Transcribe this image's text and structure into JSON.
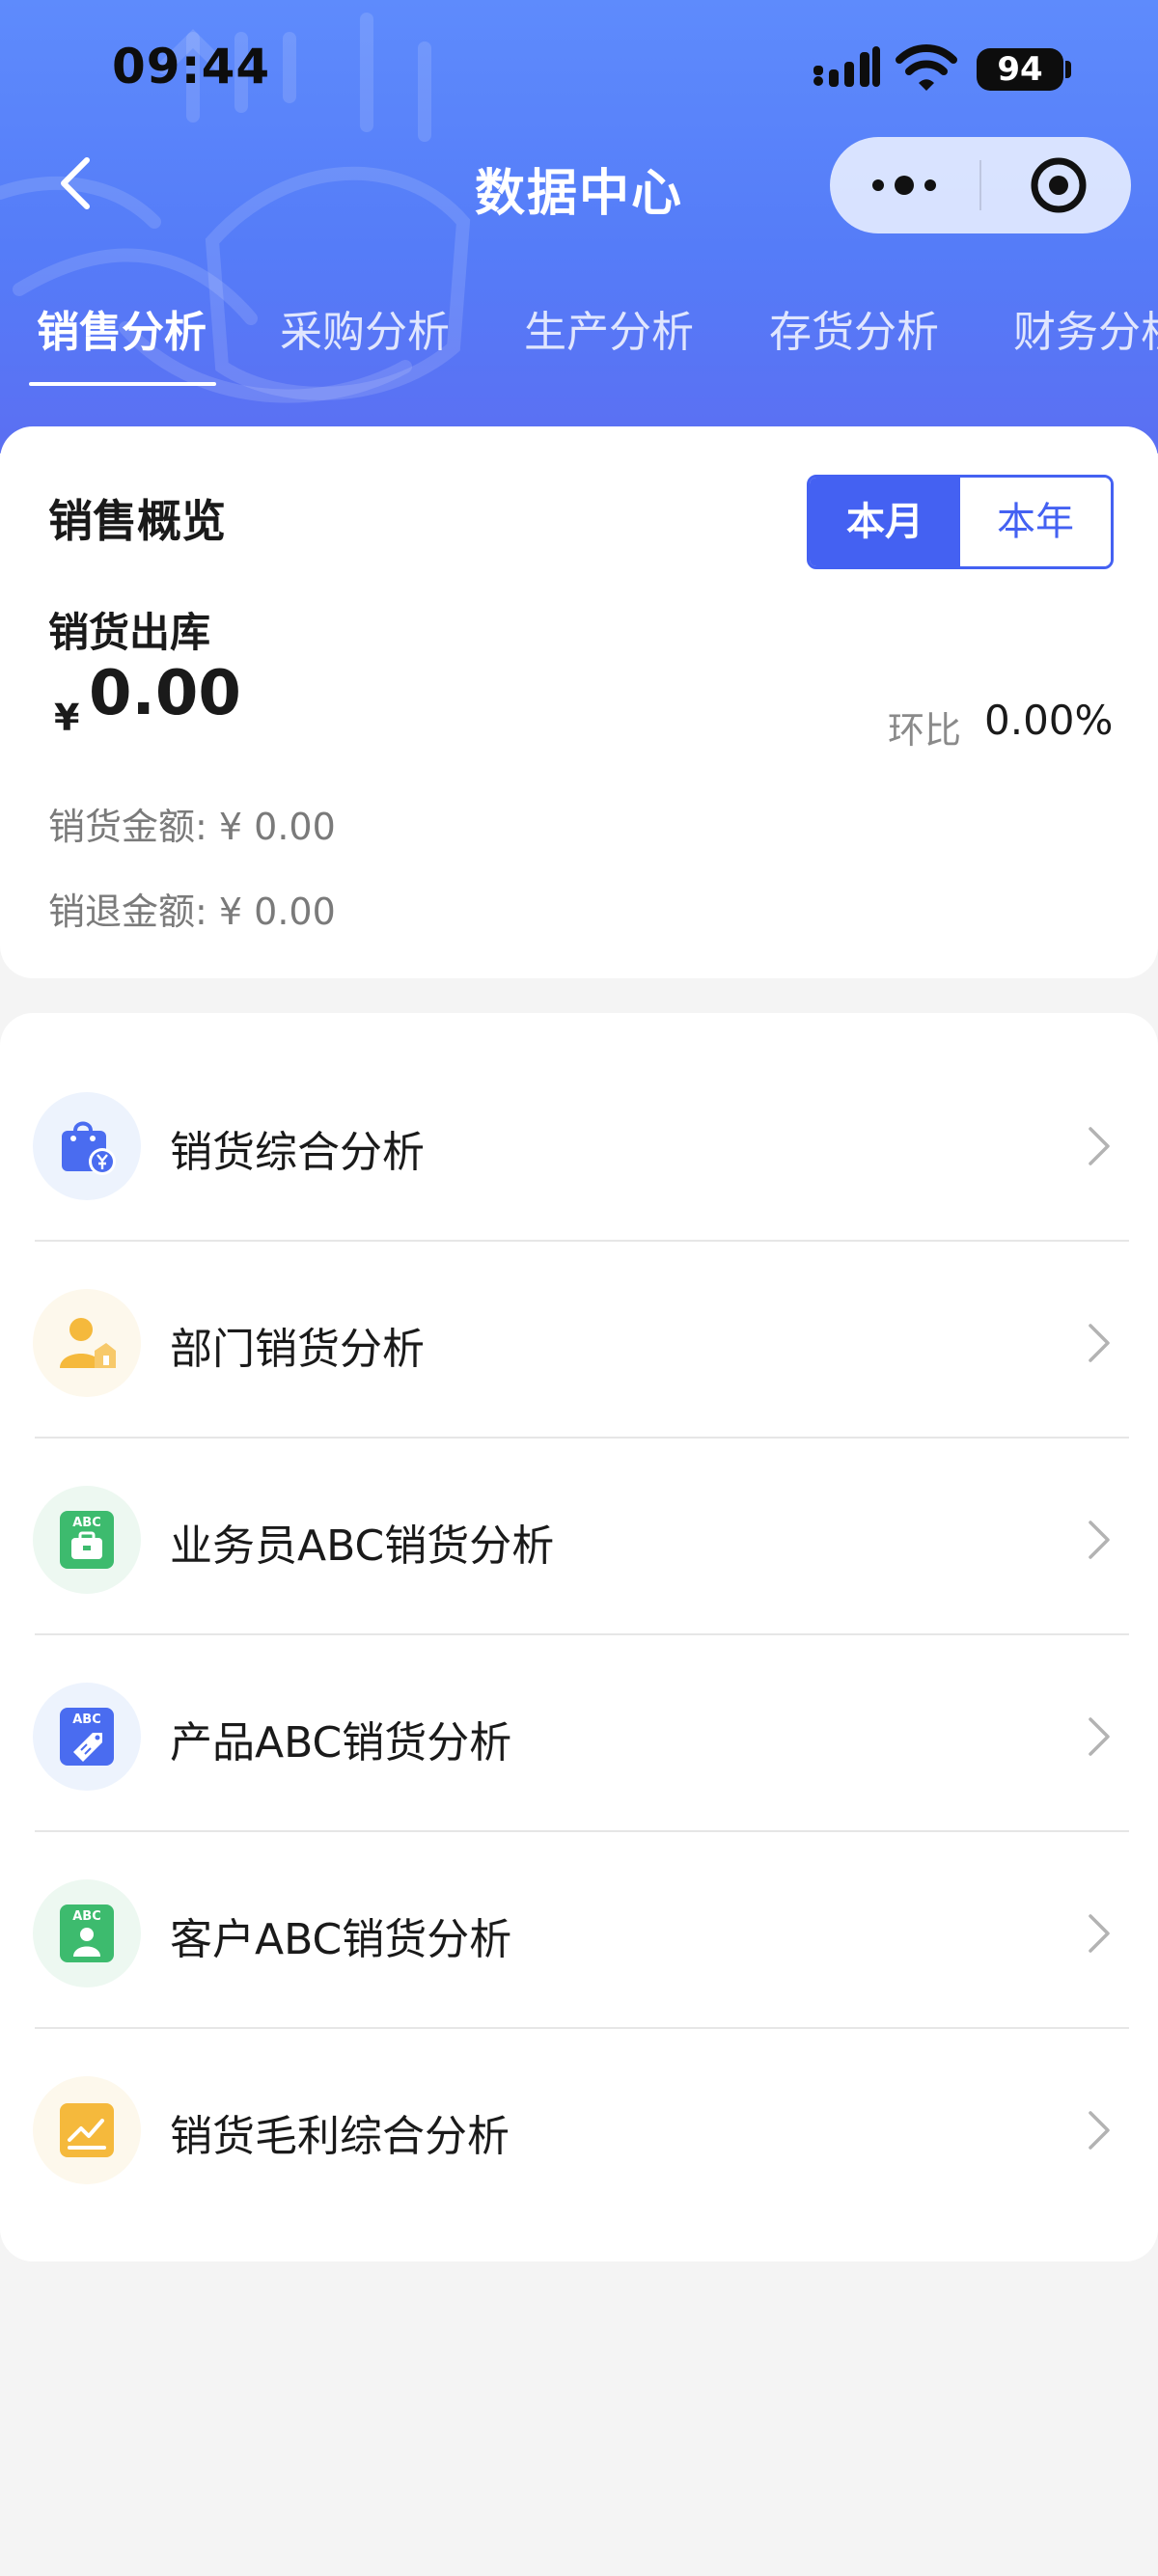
{
  "status_bar": {
    "time": "09:44",
    "battery": "94"
  },
  "nav": {
    "title": "数据中心"
  },
  "tabs": [
    {
      "label": "销售分析",
      "active": true
    },
    {
      "label": "采购分析",
      "active": false
    },
    {
      "label": "生产分析",
      "active": false
    },
    {
      "label": "存货分析",
      "active": false
    },
    {
      "label": "财务分析",
      "active": false
    }
  ],
  "overview": {
    "title": "销售概览",
    "period_options": [
      "本月",
      "本年"
    ],
    "selected_period": "本月",
    "subtitle": "销货出库",
    "currency_symbol": "¥",
    "amount": "0.00",
    "ratio_label": "环比",
    "ratio_value": "0.00%",
    "sales_amount_line": "销货金额: ¥ 0.00",
    "return_amount_line": "销退金额: ¥ 0.00"
  },
  "menu": [
    {
      "label": "销货综合分析",
      "icon": "shopping-bag-yen-icon",
      "icon_color": "#4a6cf0",
      "icon_bg": "#edf3fd"
    },
    {
      "label": "部门销货分析",
      "icon": "department-person-icon",
      "icon_color": "#f5b93c",
      "icon_bg": "#fdf8ec"
    },
    {
      "label": "业务员ABC销货分析",
      "icon": "abc-briefcase-icon",
      "icon_color": "#3dbb6e",
      "icon_bg": "#edf8f1"
    },
    {
      "label": "产品ABC销货分析",
      "icon": "abc-tag-icon",
      "icon_color": "#4a6cf0",
      "icon_bg": "#edf3fd"
    },
    {
      "label": "客户ABC销货分析",
      "icon": "abc-customer-icon",
      "icon_color": "#3dbb6e",
      "icon_bg": "#edf8f1"
    },
    {
      "label": "销货毛利综合分析",
      "icon": "trend-chart-icon",
      "icon_color": "#f5b93c",
      "icon_bg": "#fdf8ec"
    }
  ],
  "colors": {
    "header_top": "#5e8bfc",
    "header_bottom": "#5b6ff2",
    "accent": "#4461f2",
    "background": "#f4f4f4"
  }
}
